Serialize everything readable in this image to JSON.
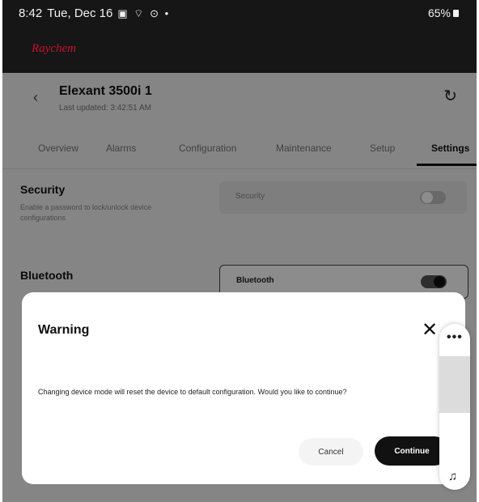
{
  "status_bar": {
    "time": "8:42",
    "date": "Tue, Dec 16",
    "icons": "▣ ⌔ ⊙ •",
    "battery": "65%"
  },
  "brand": "Raychem",
  "device": {
    "title": "Elexant 3500i 1",
    "last_updated": "Last updated: 3:42:51 AM"
  },
  "tabs": [
    {
      "label": "Overview",
      "active": false
    },
    {
      "label": "Alarms",
      "active": false
    },
    {
      "label": "Configuration",
      "active": false
    },
    {
      "label": "Maintenance",
      "active": false
    },
    {
      "label": "Setup",
      "active": false
    },
    {
      "label": "Settings",
      "active": true
    }
  ],
  "settings": {
    "security": {
      "title": "Security",
      "description": "Enable a password to lock/unlock device configurations",
      "field_label": "Security",
      "enabled": false
    },
    "bluetooth": {
      "title": "Bluetooth",
      "field_label": "Bluetooth",
      "enabled": true
    }
  },
  "dialog": {
    "title": "Warning",
    "message": "Changing device mode will reset the device to default configuration. Would you like to continue?",
    "cancel_label": "Cancel",
    "continue_label": "Continue"
  },
  "icons": {
    "back": "chevron-left-icon",
    "refresh": "refresh-icon",
    "close": "close-icon",
    "more": "more-horizontal-icon",
    "note": "music-note-icon"
  },
  "colors": {
    "brand": "#c8102e",
    "topbar": "#161616",
    "primary_button": "#111111"
  }
}
